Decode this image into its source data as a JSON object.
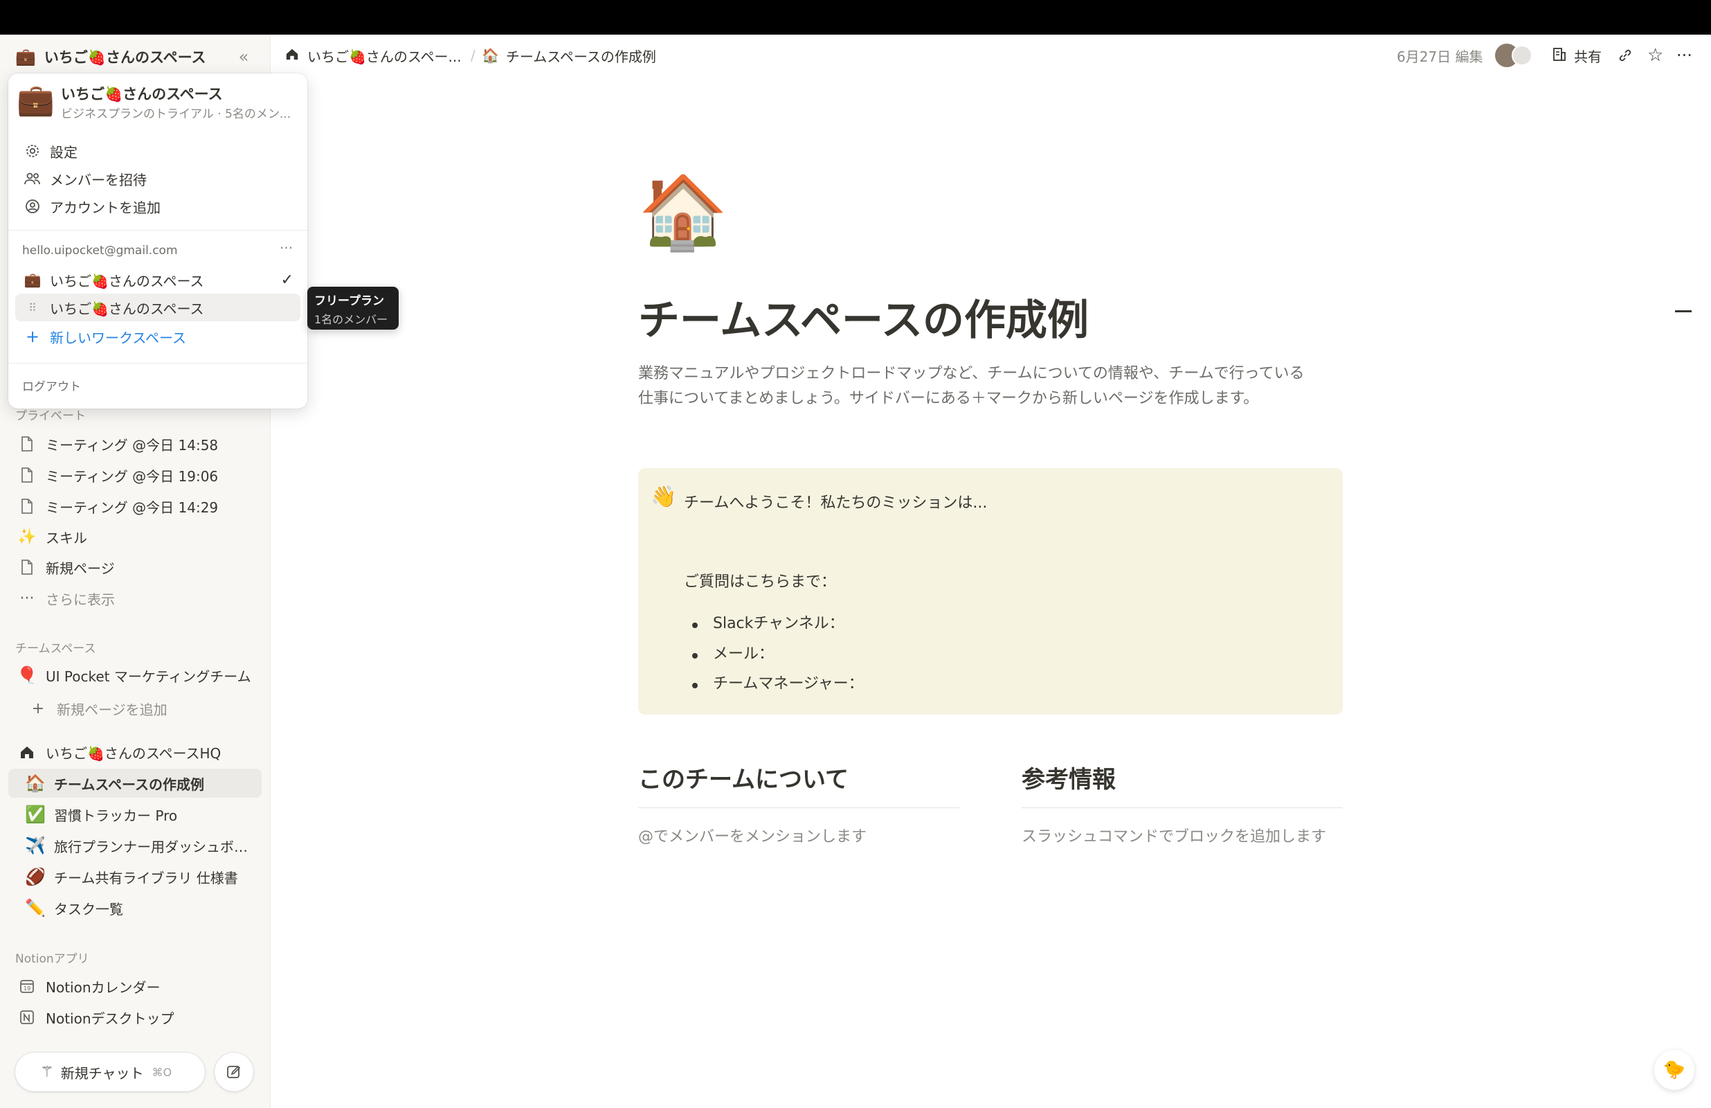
{
  "workspace": {
    "name": "いちご🍓さんのスペース",
    "plan_summary": "ビジネスプランのトライアル · 5名のメン..."
  },
  "menu": {
    "settings": "設定",
    "invite": "メンバーを招待",
    "add_account": "アカウントを追加",
    "email": "hello.uipocket@gmail.com",
    "ws1": "いちご🍓さんのスペース",
    "ws2": "いちご🍓さんのスペース",
    "new_ws": "新しいワークスペース",
    "logout": "ログアウト"
  },
  "tooltip": {
    "title": "フリープラン",
    "sub": "1名のメンバー"
  },
  "sidebar": {
    "private_label": "プライベート",
    "private": [
      {
        "label": "ミーティング @今日 14:58"
      },
      {
        "label": "ミーティング @今日 19:06"
      },
      {
        "label": "ミーティング @今日 14:29"
      },
      {
        "label": "スキル"
      },
      {
        "label": "新規ページ"
      },
      {
        "label": "さらに表示"
      }
    ],
    "team_label": "チームスペース",
    "team": [
      {
        "label": "UI Pocket マーケティングチーム"
      },
      {
        "label": "新規ページを追加"
      },
      {
        "label": "いちご🍓さんのスペースHQ"
      },
      {
        "label": "チームスペースの作成例"
      },
      {
        "label": "習慣トラッカー Pro"
      },
      {
        "label": "旅行プランナー用ダッシュボード"
      },
      {
        "label": "チーム共有ライブラリ 仕様書"
      },
      {
        "label": "タスク一覧"
      }
    ],
    "apps_label": "Notionアプリ",
    "apps": [
      {
        "label": "Notionカレンダー"
      },
      {
        "label": "Notionデスクトップ"
      }
    ],
    "new_chat": "新規チャット",
    "new_chat_shortcut": "⌘O"
  },
  "breadcrumb": {
    "home": "いちご🍓さんのスペー...",
    "page": "チームスペースの作成例"
  },
  "topbar": {
    "edited": "6月27日 編集",
    "share": "共有"
  },
  "page": {
    "title": "チームスペースの作成例",
    "desc_line1": "業務マニュアルやプロジェクトロードマップなど、チームについての情報や、チームで行っている",
    "desc_line2": "仕事についてまとめましょう。サイドバーにある＋マークから新しいページを作成します。",
    "callout": {
      "heading": "チームへようこそ！私たちのミッションは...",
      "question": "ご質問はこちらまで：",
      "items": [
        "Slackチャンネル：",
        "メール：",
        "チームマネージャー："
      ]
    },
    "col1": {
      "title": "このチームについて",
      "text": "@でメンバーをメンションします"
    },
    "col2": {
      "title": "参考情報",
      "text": "スラッシュコマンドでブロックを追加します"
    }
  }
}
